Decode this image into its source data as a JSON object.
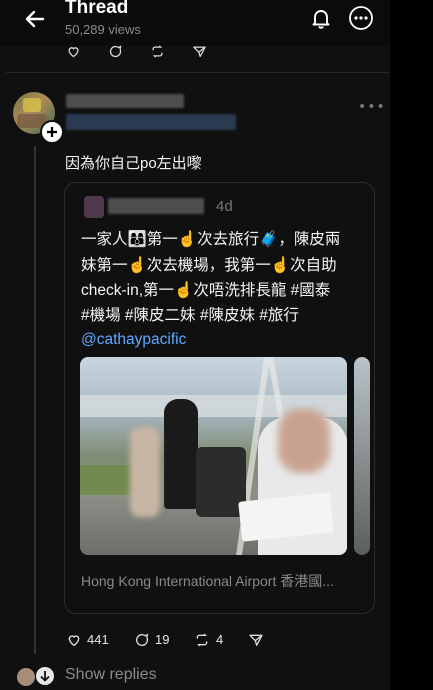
{
  "header": {
    "title": "Thread",
    "views": "50,289 views"
  },
  "reply": {
    "text": "因為你自己po左出嚟"
  },
  "quoted": {
    "age": "4d",
    "lines": [
      "一家人👩‍👩‍👦第一☝次去旅行🧳，陳皮兩",
      "妹第一☝次去機場，我第一☝次自助",
      "check-in,第一☝次唔洗排長龍 #國泰",
      "#機場 #陳皮二妹 #陳皮妹 #旅行"
    ],
    "mention": "@cathaypacific",
    "location": "Hong Kong International Airport 香港國..."
  },
  "stats": {
    "likes": "441",
    "replies": "19",
    "reposts": "4"
  },
  "footer": {
    "show_replies": "Show replies"
  },
  "colors": {
    "bg": "#101010",
    "accent_blue": "#5fa8ff",
    "muted": "#8a8a8a"
  }
}
